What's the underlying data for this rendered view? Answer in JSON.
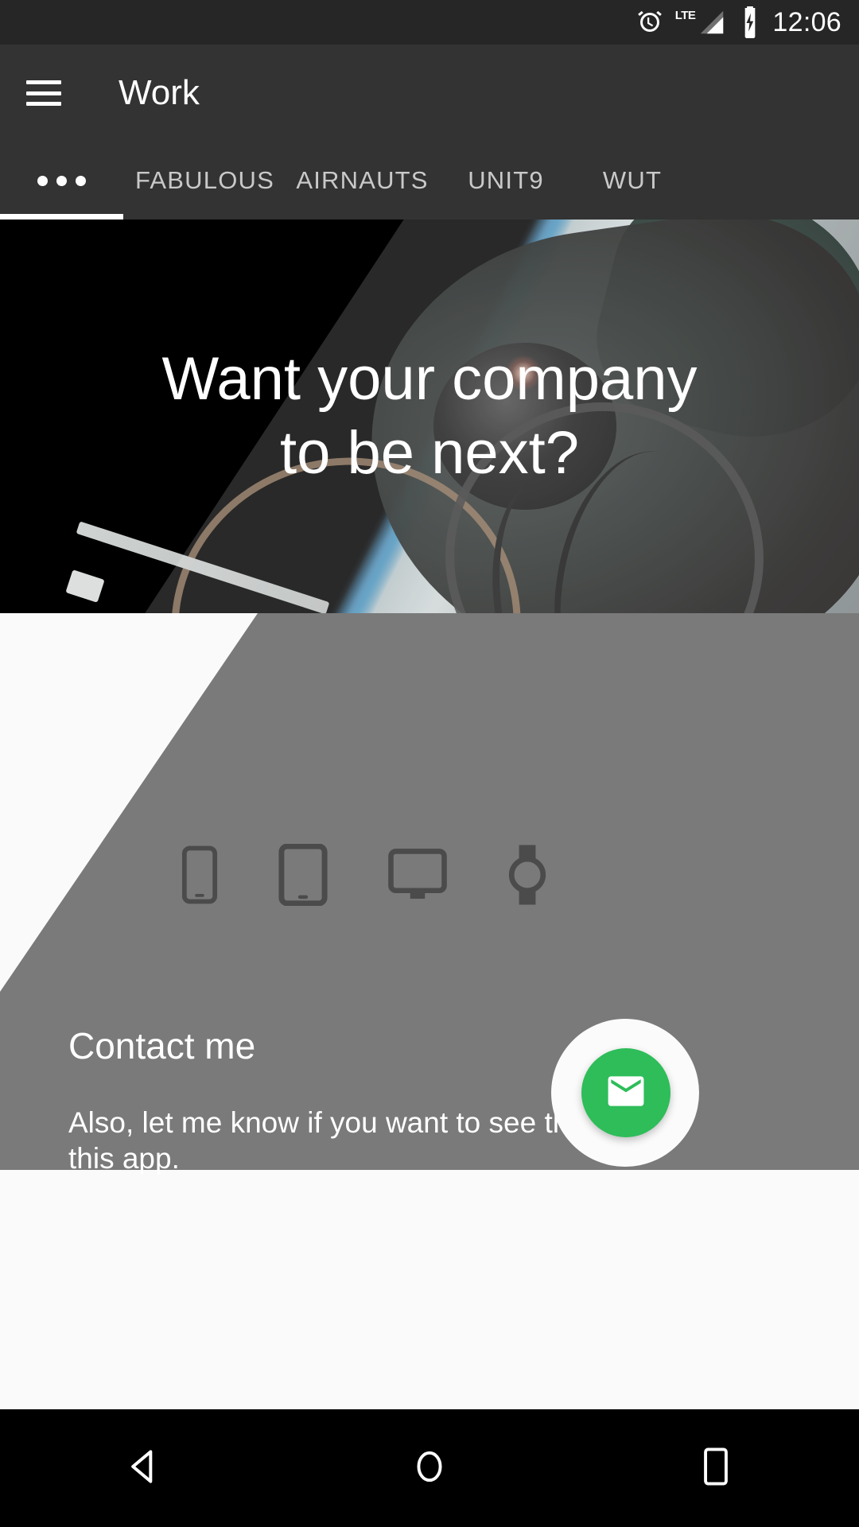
{
  "status_bar": {
    "time": "12:06",
    "icons": [
      "alarm-clock-icon",
      "lte-signal-icon",
      "battery-charging-icon"
    ],
    "network_label": "LTE",
    "background_color": "#262626"
  },
  "toolbar": {
    "menu_icon": "hamburger-menu-icon",
    "title": "Work",
    "background_color": "#333333"
  },
  "tabs": {
    "active_index": 0,
    "indicator_color": "#ffffff",
    "items": [
      {
        "label": "•••",
        "name": "overview",
        "active": true
      },
      {
        "label": "FABULOUS",
        "name": "fabulous",
        "active": false
      },
      {
        "label": "AIRNAUTS",
        "name": "airnauts",
        "active": false
      },
      {
        "label": "UNIT9",
        "name": "unit9",
        "active": false
      },
      {
        "label": "WUT",
        "name": "wut",
        "active": false
      }
    ]
  },
  "hero": {
    "image_description": "astronaut-spacewalk-photo",
    "title_line_1": "Want your company",
    "title_line_2": "to be next?",
    "title_color": "#ffffff"
  },
  "devices": {
    "items": [
      {
        "name": "phone-icon",
        "label": "phone"
      },
      {
        "name": "tablet-icon",
        "label": "tablet"
      },
      {
        "name": "desktop-icon",
        "label": "desktop"
      },
      {
        "name": "watch-icon",
        "label": "watch"
      }
    ],
    "icon_color": "#424242"
  },
  "contact": {
    "heading": "Contact me",
    "body": "Also, let me know if you want to see the code of this app.",
    "text_color": "#ffffff"
  },
  "fab": {
    "icon": "email-envelope-icon",
    "background_color": "#2ebd59",
    "icon_color": "#ffffff",
    "reveal_color": "#fbfbfb"
  },
  "nav_bar": {
    "background_color": "#000000",
    "buttons": [
      {
        "name": "back-button",
        "icon": "back-triangle-icon"
      },
      {
        "name": "home-button",
        "icon": "home-circle-icon"
      },
      {
        "name": "recents-button",
        "icon": "recents-square-icon"
      }
    ]
  },
  "panel": {
    "background_color": "#616161",
    "page_background_color": "#fafafa"
  }
}
